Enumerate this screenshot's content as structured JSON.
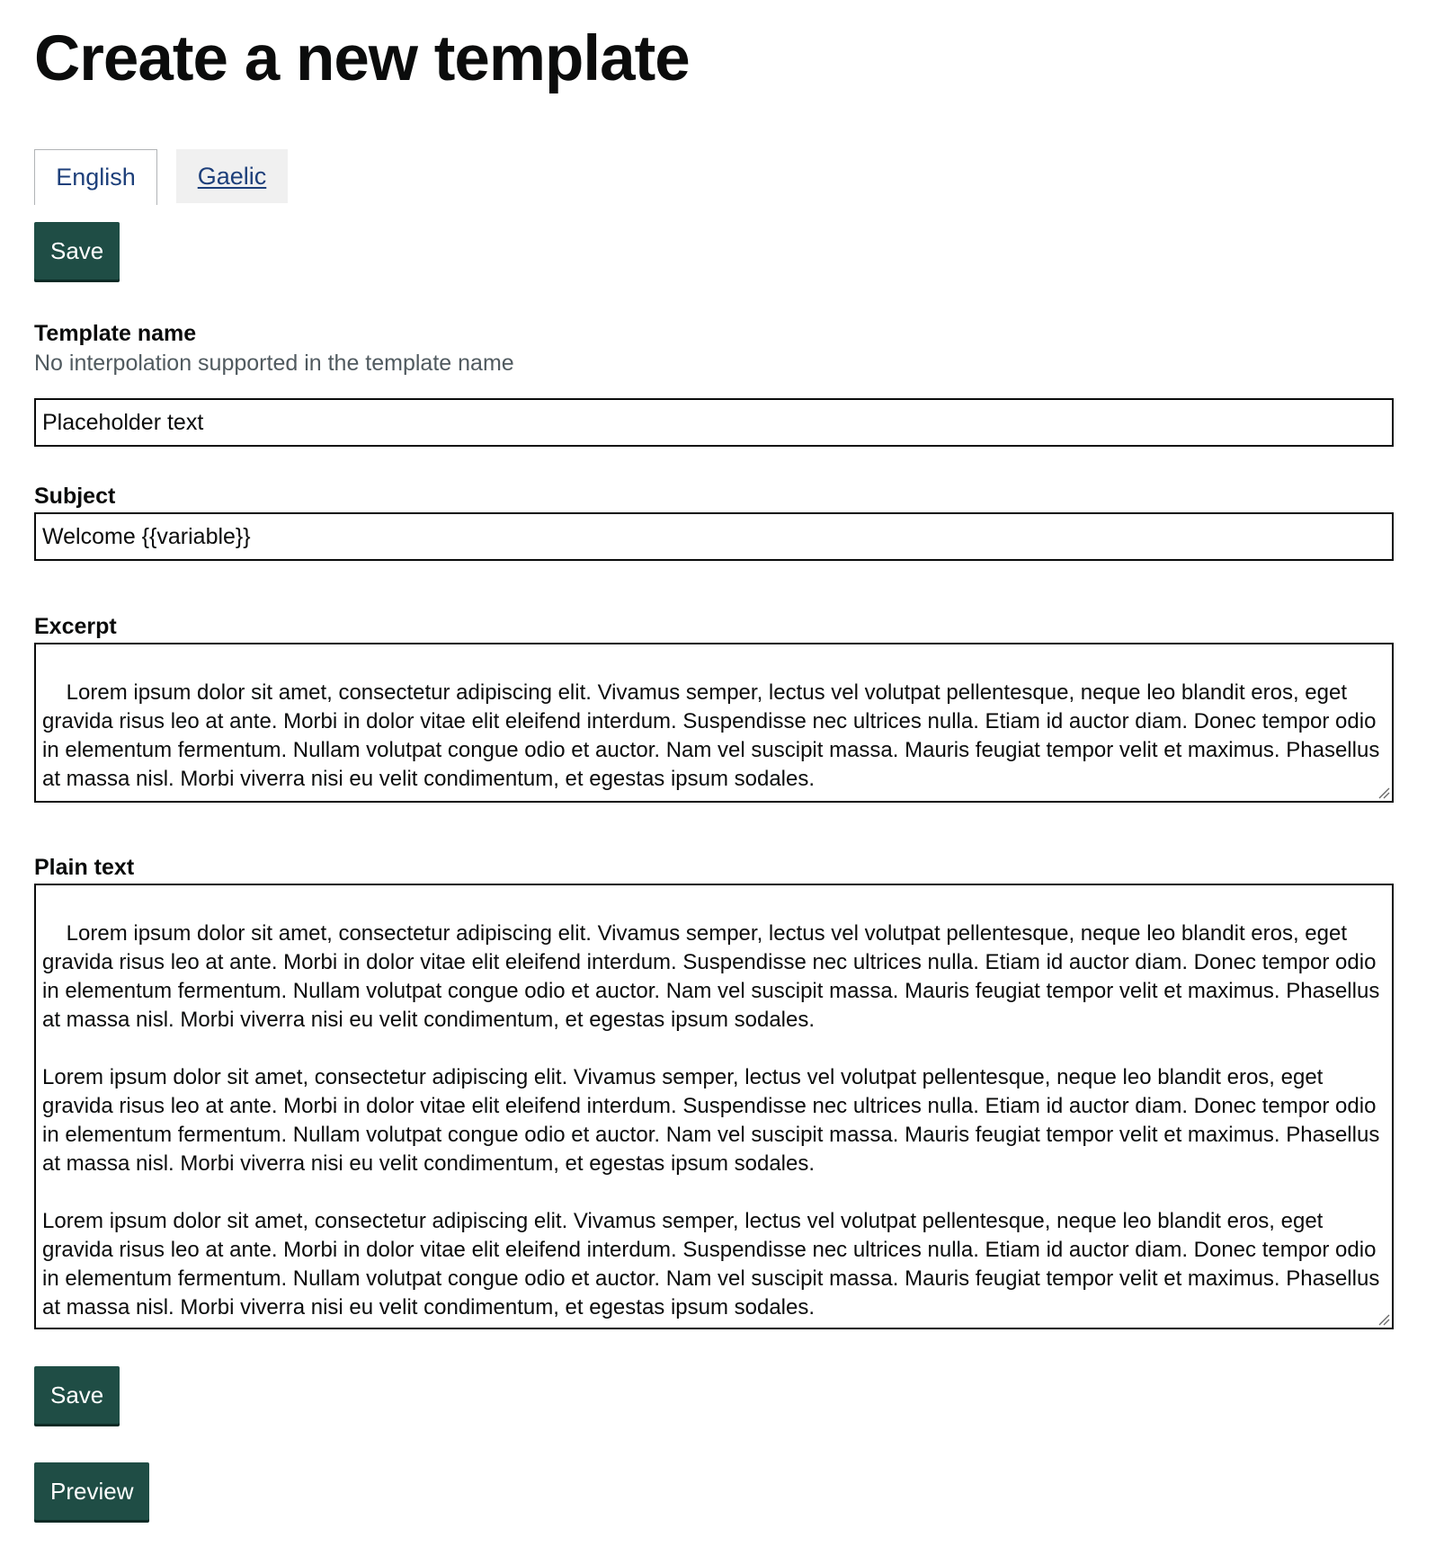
{
  "page": {
    "title": "Create a new template"
  },
  "tabs": [
    {
      "label": "English",
      "active": true
    },
    {
      "label": "Gaelic",
      "active": false
    }
  ],
  "buttons": {
    "save_top": "Save",
    "save_bottom": "Save",
    "preview": "Preview"
  },
  "fields": {
    "template_name": {
      "label": "Template name",
      "hint": "No interpolation supported in the template name",
      "value": "Placeholder text"
    },
    "subject": {
      "label": "Subject",
      "value": "Welcome {{variable}}"
    },
    "excerpt": {
      "label": "Excerpt",
      "value": "Lorem ipsum dolor sit amet, consectetur adipiscing elit. Vivamus semper, lectus vel volutpat pellentesque, neque leo blandit eros, eget gravida risus leo at ante. Morbi in dolor vitae elit eleifend interdum. Suspendisse nec ultrices nulla. Etiam id auctor diam. Donec tempor odio in elementum fermentum. Nullam volutpat congue odio et auctor. Nam vel suscipit massa. Mauris feugiat tempor velit et maximus. Phasellus at massa nisl. Morbi viverra nisi eu velit condimentum, et egestas ipsum sodales."
    },
    "plain_text": {
      "label": "Plain text",
      "value": "Lorem ipsum dolor sit amet, consectetur adipiscing elit. Vivamus semper, lectus vel volutpat pellentesque, neque leo blandit eros, eget gravida risus leo at ante. Morbi in dolor vitae elit eleifend interdum. Suspendisse nec ultrices nulla. Etiam id auctor diam. Donec tempor odio in elementum fermentum. Nullam volutpat congue odio et auctor. Nam vel suscipit massa. Mauris feugiat tempor velit et maximus. Phasellus at massa nisl. Morbi viverra nisi eu velit condimentum, et egestas ipsum sodales.\n\nLorem ipsum dolor sit amet, consectetur adipiscing elit. Vivamus semper, lectus vel volutpat pellentesque, neque leo blandit eros, eget gravida risus leo at ante. Morbi in dolor vitae elit eleifend interdum. Suspendisse nec ultrices nulla. Etiam id auctor diam. Donec tempor odio in elementum fermentum. Nullam volutpat congue odio et auctor. Nam vel suscipit massa. Mauris feugiat tempor velit et maximus. Phasellus at massa nisl. Morbi viverra nisi eu velit condimentum, et egestas ipsum sodales.\n\nLorem ipsum dolor sit amet, consectetur adipiscing elit. Vivamus semper, lectus vel volutpat pellentesque, neque leo blandit eros, eget gravida risus leo at ante. Morbi in dolor vitae elit eleifend interdum. Suspendisse nec ultrices nulla. Etiam id auctor diam. Donec tempor odio in elementum fermentum. Nullam volutpat congue odio et auctor. Nam vel suscipit massa. Mauris feugiat tempor velit et maximus. Phasellus at massa nisl. Morbi viverra nisi eu velit condimentum, et egestas ipsum sodales."
    }
  },
  "colors": {
    "button_bg": "#1f4d45",
    "link": "#1d3f7a",
    "hint_text": "#505a5f",
    "border": "#0b0c0c"
  },
  "icons": {
    "resize_handle": "resize-handle-icon"
  }
}
